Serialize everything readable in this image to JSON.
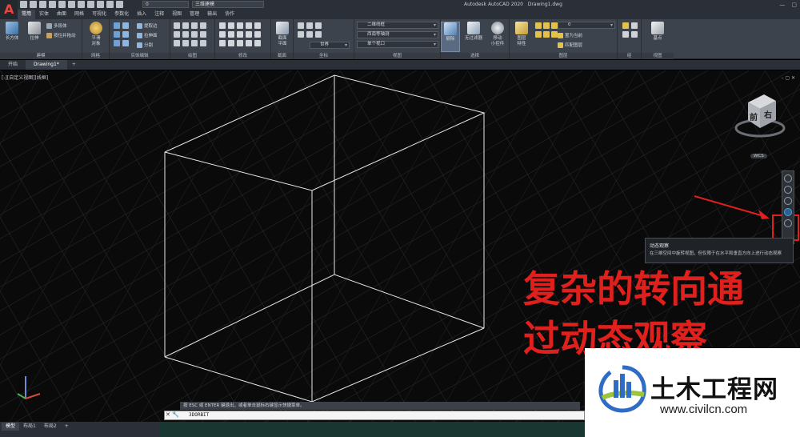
{
  "app": {
    "title": "Autodesk AutoCAD 2020",
    "document": "Drawing1.dwg",
    "app_letter": "A",
    "layer_value": "0",
    "workspace": "三维建模"
  },
  "ribbon_tabs": [
    "常用",
    "实体",
    "曲面",
    "网格",
    "可视化",
    "参数化",
    "插入",
    "注释",
    "视图",
    "管理",
    "输出",
    "协作"
  ],
  "ribbon": {
    "modeling": {
      "label": "建模",
      "box": "长方体",
      "extrude": "拉伸",
      "polysolid": "多段体",
      "presspull": "按住并拖动"
    },
    "mesh": {
      "label": "网格",
      "smooth": "平滑\n对象"
    },
    "solid_edit": {
      "label": "实体编辑",
      "extract": "提取边",
      "extrude_face": "拉伸面",
      "separate": "分割"
    },
    "draw": {
      "label": "绘图"
    },
    "modify": {
      "label": "修改"
    },
    "section": {
      "label": "截面",
      "plane": "截面\n平面"
    },
    "coords": {
      "label": "坐标",
      "world": "世界"
    },
    "view": {
      "label": "视图",
      "visual_style": "二维线框",
      "view_preset": "西南等轴测",
      "single_viewport": "单个视口"
    },
    "selection": {
      "label": "选择",
      "cull": "剔除",
      "no_filter": "无过滤器",
      "gizmo": "移动\n小控件"
    },
    "layers": {
      "label": "图层",
      "props": "图层\n特性",
      "set_current": "置为当前",
      "match": "匹配图层"
    },
    "groups": {
      "label": "组"
    },
    "view2": {
      "label": "视图",
      "base": "基点"
    }
  },
  "doc_tabs": [
    "开始",
    "Drawing1*"
  ],
  "viewport": {
    "label": "[-][自定义视图][线框]",
    "cube_face_1": "前",
    "cube_face_2": "右",
    "cube_wcs": "WCS"
  },
  "tooltip": {
    "title": "动态观察",
    "body": "在三维空间中旋转视图，但仅限于在水平和垂直方向上进行动态观察"
  },
  "annotation": {
    "line1": "复杂的转向通",
    "line2": "过动态观察"
  },
  "watermark": {
    "name": "土木工程网",
    "url": "www.civilcn.com"
  },
  "command": {
    "history": "按 ESC 或 ENTER 键退出，或者单击鼠标右键显示快捷菜单。",
    "input": "3DORBIT"
  },
  "layout_tabs": [
    "模型",
    "布局1",
    "布局2"
  ],
  "colors": {
    "accent_red": "#e0201c",
    "highlight_box": "#e0201c",
    "viewport_bg": "#0a0a0a",
    "ribbon_bg": "#3d434d"
  }
}
